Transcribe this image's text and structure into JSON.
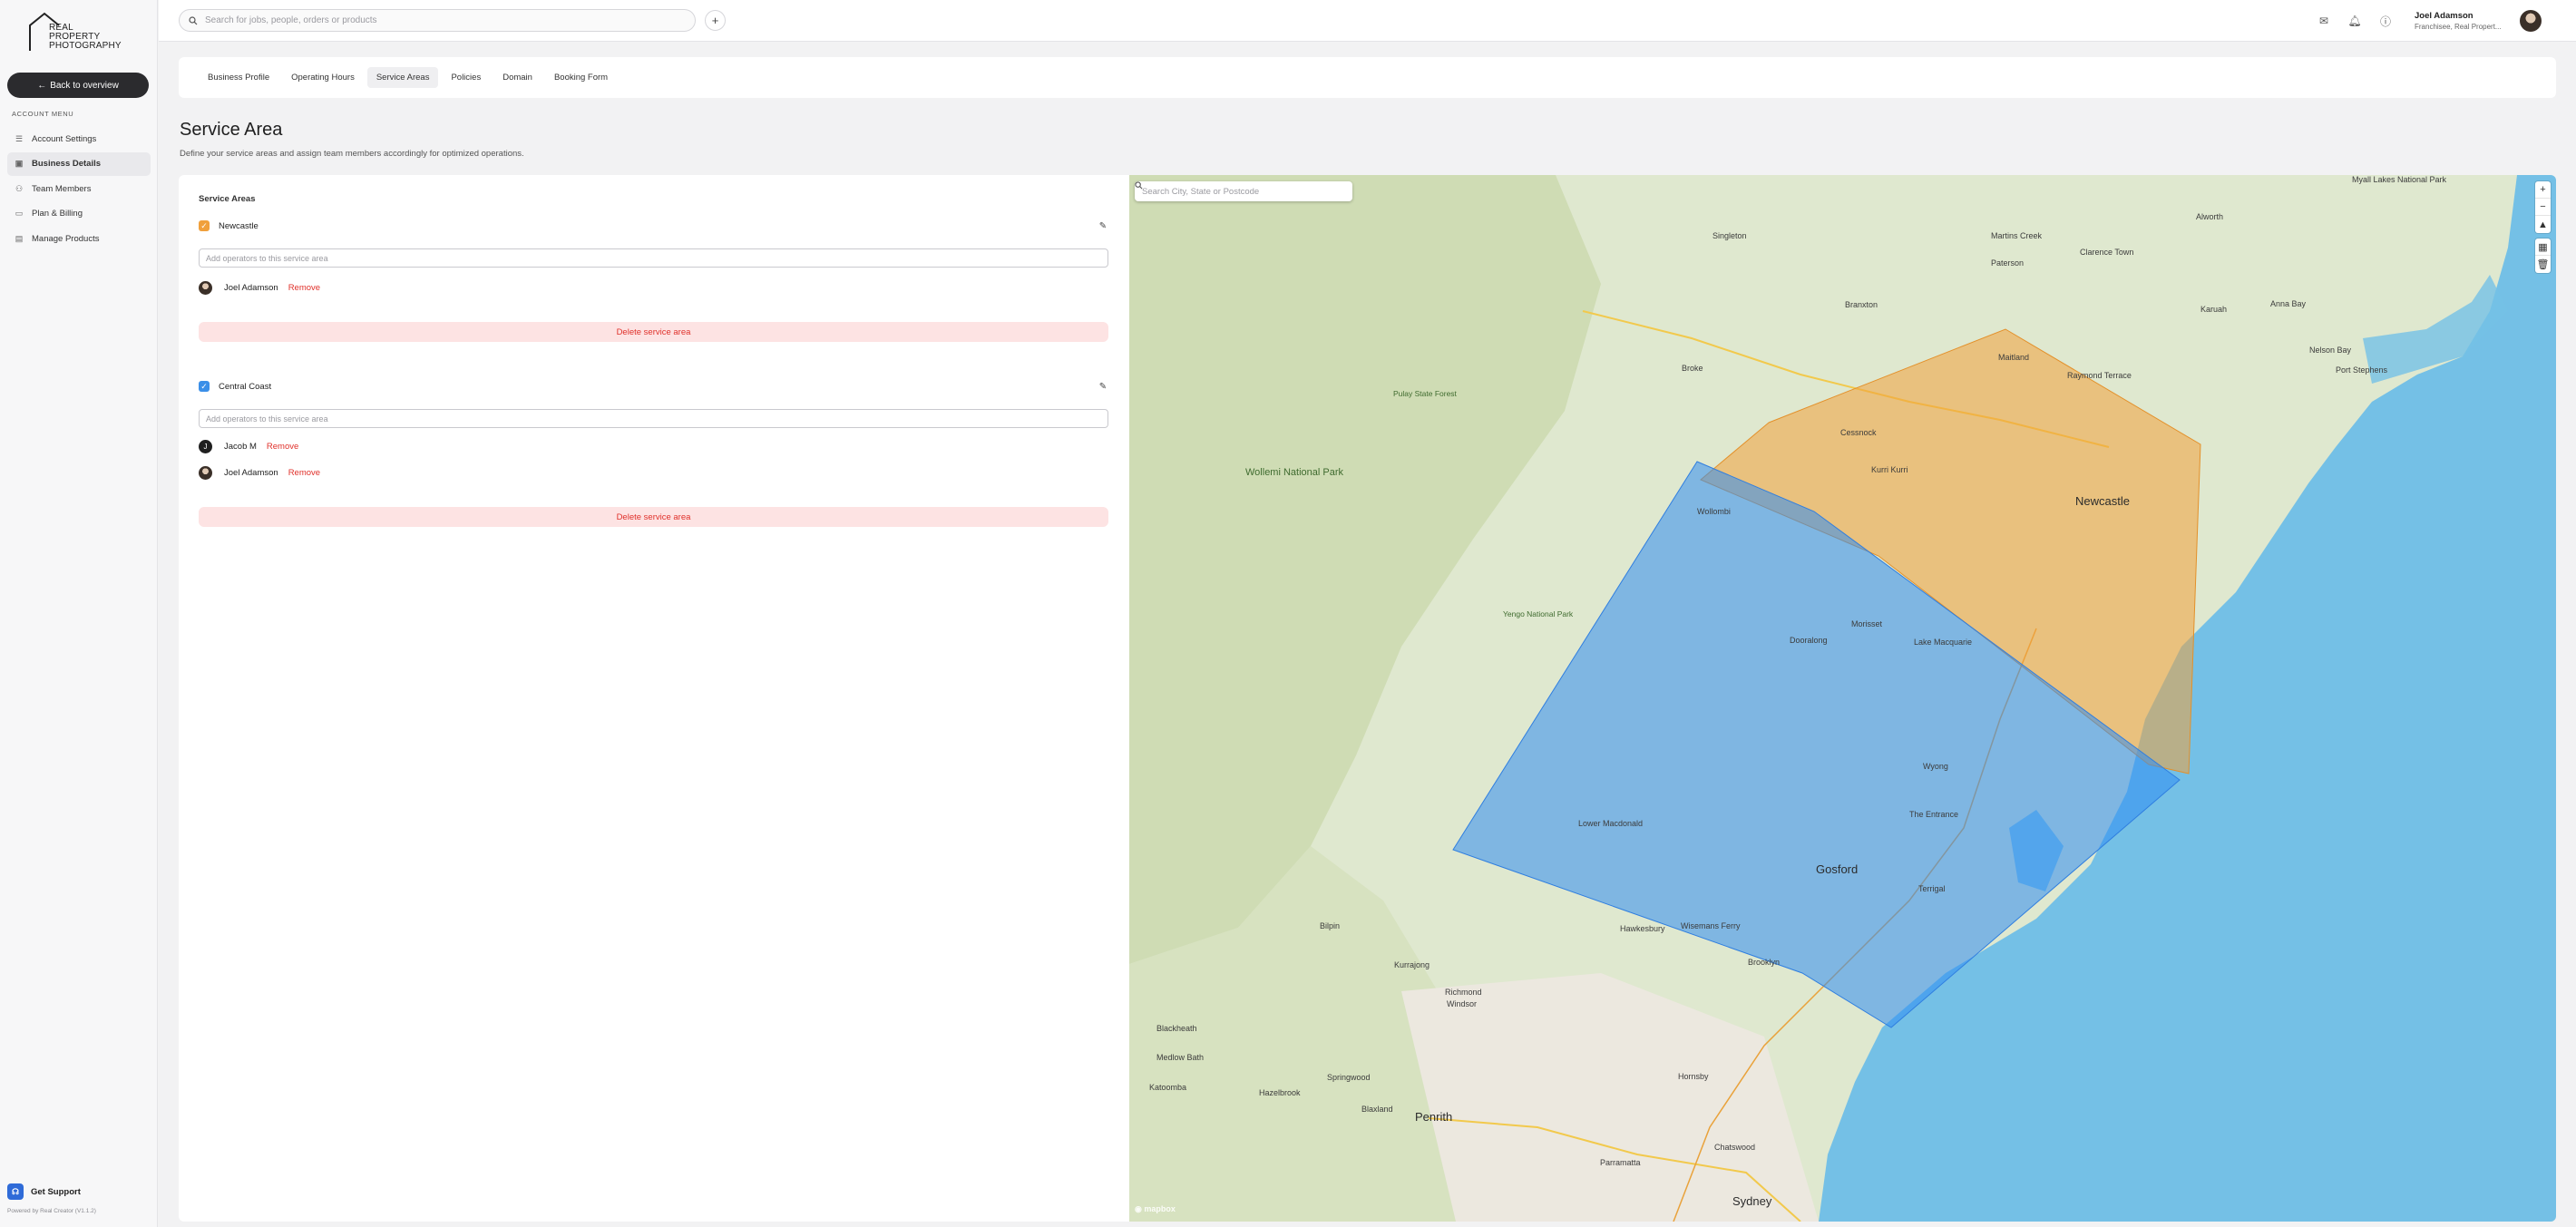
{
  "brand": {
    "logo_line1": "REAL",
    "logo_line2": "PROPERTY",
    "logo_line3": "PHOTOGRAPHY"
  },
  "sidebar": {
    "back_label": "Back to overview",
    "menu_title": "ACCOUNT MENU",
    "items": [
      {
        "label": "Account Settings",
        "icon": "sliders-icon"
      },
      {
        "label": "Business Details",
        "icon": "briefcase-icon"
      },
      {
        "label": "Team Members",
        "icon": "users-icon"
      },
      {
        "label": "Plan & Billing",
        "icon": "card-icon"
      },
      {
        "label": "Manage Products",
        "icon": "box-icon"
      }
    ],
    "active_item": "Business Details",
    "support_label": "Get Support",
    "powered_by": "Powered by Real Creator (V1.1.2)"
  },
  "topbar": {
    "search_placeholder": "Search for jobs, people, orders or products",
    "user_name": "Joel Adamson",
    "user_role": "Franchisee, Real Propert..."
  },
  "tabs": {
    "items": [
      "Business Profile",
      "Operating Hours",
      "Service Areas",
      "Policies",
      "Domain",
      "Booking Form"
    ],
    "active": "Service Areas"
  },
  "page": {
    "title": "Service Area",
    "subtitle": "Define your service areas and assign team members accordingly for optimized operations."
  },
  "service_areas": {
    "heading": "Service Areas",
    "input_placeholder": "Add operators to this service area",
    "remove_label": "Remove",
    "delete_label": "Delete service area",
    "areas": [
      {
        "name": "Newcastle",
        "checked": true,
        "color": "#f0a03c",
        "operators": [
          {
            "name": "Joel Adamson",
            "avatar": "photo"
          }
        ]
      },
      {
        "name": "Central Coast",
        "checked": true,
        "color": "#3b8fe8",
        "operators": [
          {
            "name": "Jacob M",
            "avatar": "J"
          },
          {
            "name": "Joel Adamson",
            "avatar": "photo"
          }
        ]
      }
    ]
  },
  "map": {
    "search_placeholder": "Search City, State or Postcode",
    "controls": [
      "+",
      "−",
      "▲",
      "▦",
      "🗑"
    ],
    "labels": [
      {
        "text": "Newcastle",
        "big": true
      },
      {
        "text": "Gosford",
        "big": true
      },
      {
        "text": "Penrith",
        "big": true
      },
      {
        "text": "Sydney",
        "big": true
      },
      {
        "text": "Wollemi National Park",
        "park": true
      },
      {
        "text": "Yengo National Park",
        "park": true
      },
      {
        "text": "Pulay State Forest",
        "park": true
      },
      {
        "text": "Maitland"
      },
      {
        "text": "Cessnock"
      },
      {
        "text": "Singleton"
      },
      {
        "text": "Branxton"
      },
      {
        "text": "Broke"
      },
      {
        "text": "Raymond Terrace"
      },
      {
        "text": "Port Stephens"
      },
      {
        "text": "Nelson Bay"
      },
      {
        "text": "Anna Bay"
      },
      {
        "text": "Wyong"
      },
      {
        "text": "The Entrance"
      },
      {
        "text": "Terrigal"
      },
      {
        "text": "Windsor"
      },
      {
        "text": "Richmond"
      },
      {
        "text": "Katoomba"
      },
      {
        "text": "Springwood"
      },
      {
        "text": "Blaxland"
      },
      {
        "text": "Parramatta"
      },
      {
        "text": "Hornsby"
      },
      {
        "text": "Chatswood"
      },
      {
        "text": "Kurrajong"
      },
      {
        "text": "Bilpin"
      },
      {
        "text": "Blackheath"
      },
      {
        "text": "Medlow Bath"
      },
      {
        "text": "Hazelbrook"
      },
      {
        "text": "Wisemans Ferry"
      },
      {
        "text": "Martins Creek"
      },
      {
        "text": "Clarence Town"
      },
      {
        "text": "Paterson"
      },
      {
        "text": "Alworth"
      },
      {
        "text": "Myall Lakes National Park"
      },
      {
        "text": "Karuah"
      },
      {
        "text": "Kurri Kurri"
      },
      {
        "text": "Wollombi"
      },
      {
        "text": "Lake Macquarie"
      },
      {
        "text": "Morisset"
      },
      {
        "text": "Dooralong"
      },
      {
        "text": "Brooklyn"
      },
      {
        "text": "Lower Macdonald"
      },
      {
        "text": "Hawkesbury"
      }
    ]
  }
}
